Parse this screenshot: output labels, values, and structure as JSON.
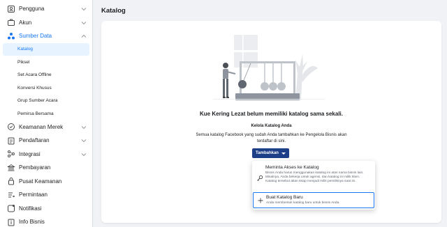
{
  "header": {
    "title": "Katalog"
  },
  "sidebar": {
    "items": [
      {
        "label": "Pengguna",
        "icon": "users-icon"
      },
      {
        "label": "Akun",
        "icon": "briefcase-icon"
      },
      {
        "label": "Sumber Data",
        "icon": "data-sources-icon"
      },
      {
        "label": "Keamanan Merek",
        "icon": "shield-icon"
      },
      {
        "label": "Pendaftaran",
        "icon": "clipboard-icon"
      },
      {
        "label": "Integrasi",
        "icon": "integration-icon"
      },
      {
        "label": "Pembayaran",
        "icon": "bank-icon"
      },
      {
        "label": "Pusat Keamanan",
        "icon": "lock-icon"
      },
      {
        "label": "Permintaan",
        "icon": "request-icon"
      },
      {
        "label": "Notifikasi",
        "icon": "notification-icon"
      },
      {
        "label": "Info Bisnis",
        "icon": "info-icon"
      }
    ],
    "sub_items": [
      {
        "label": "Katalog"
      },
      {
        "label": "Piksel"
      },
      {
        "label": "Set Acara Offline"
      },
      {
        "label": "Konversi Khusus"
      },
      {
        "label": "Grup Sumber Acara"
      },
      {
        "label": "Pemirsa Bersama"
      }
    ]
  },
  "main": {
    "empty_title": "Kue Kering Lezat belum memiliki katalog sama sekali.",
    "manage_title": "Kelola Katalog Anda",
    "manage_desc": "Semua katalog Facebook yang sudah Anda tambahkan ke Pengelola Bisnis akan terdaftar di sini.",
    "add_button": "Tambahkan"
  },
  "dropdown": {
    "request_title": "Meminta Akses ke Katalog",
    "request_desc": "Bisnis Anda harus menggunakan katalog ini atas nama bisnis lain. Misalnya, Anda bekerja untuk agensi, dan katalog ini milik klien. Katalog tersebut akan tetap menjadi milik pemiliknya saat ini.",
    "create_title": "Buat Katalog Baru",
    "create_desc": "Anda membentuk katalog baru untuk bisnis Anda."
  },
  "colors": {
    "accent": "#1877f2",
    "button": "#1d3f88",
    "selected_bg": "#e7f3ff"
  }
}
